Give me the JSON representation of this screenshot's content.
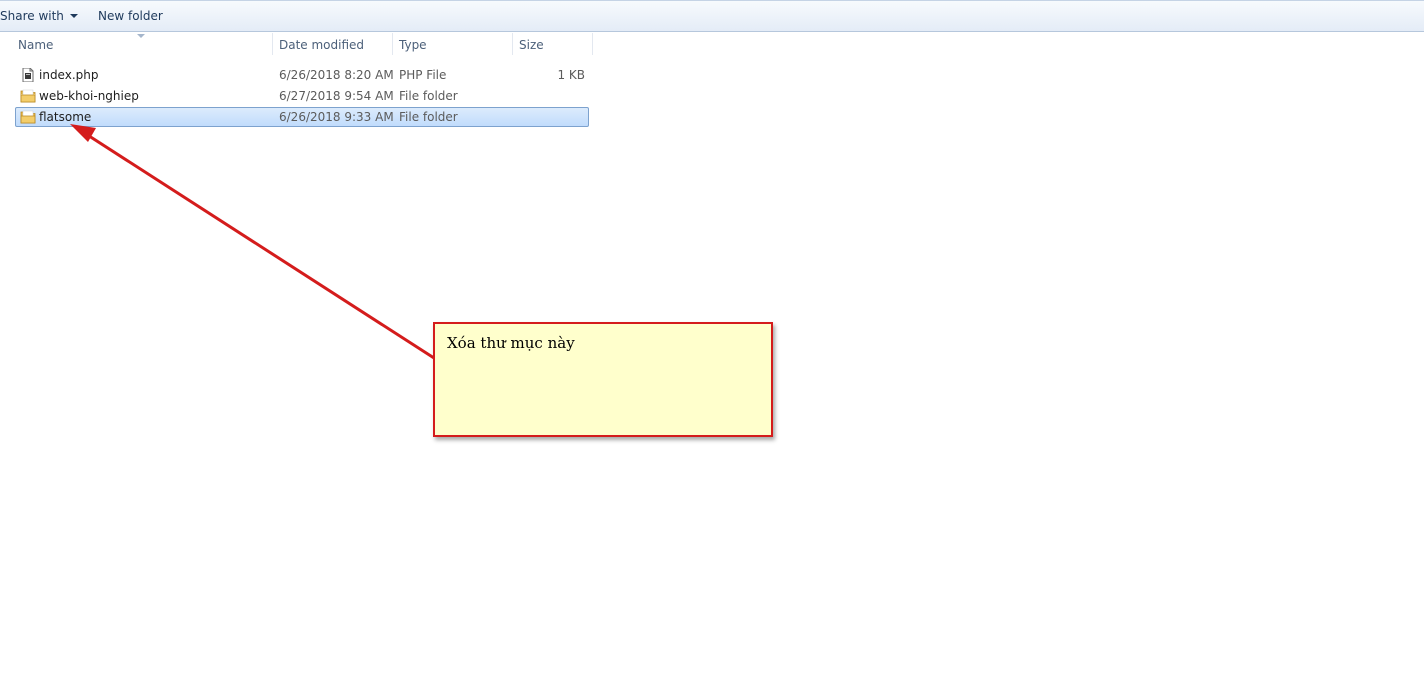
{
  "toolbar": {
    "share_label": "Share with",
    "new_folder_label": "New folder"
  },
  "columns": {
    "name": "Name",
    "date": "Date modified",
    "type": "Type",
    "size": "Size"
  },
  "files": [
    {
      "name": "index.php",
      "date": "6/26/2018 8:20 AM",
      "type": "PHP File",
      "size": "1 KB",
      "icon": "php-file-icon",
      "selected": false
    },
    {
      "name": "web-khoi-nghiep",
      "date": "6/27/2018 9:54 AM",
      "type": "File folder",
      "size": "",
      "icon": "folder-icon",
      "selected": false
    },
    {
      "name": "flatsome",
      "date": "6/26/2018 9:33 AM",
      "type": "File folder",
      "size": "",
      "icon": "folder-icon",
      "selected": true
    }
  ],
  "annotation": {
    "text": "Xóa thư mục này"
  },
  "colors": {
    "accent": "#d41c1c",
    "note_bg": "#ffffcc",
    "selection": "#cce4ff"
  }
}
